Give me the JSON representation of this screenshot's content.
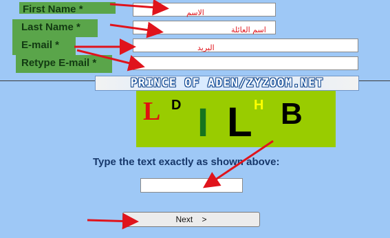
{
  "form": {
    "first_name_label": "First Name *",
    "last_name_label": "Last Name *",
    "email_label": "E-mail *",
    "retype_email_label": "Retype E-mail *",
    "first_name_hint": "الاسم",
    "last_name_hint": "اسم العائلة",
    "email_hint": "البريد"
  },
  "banner": {
    "text": "PRINCE OF ADEN/ZYZOOM.NET"
  },
  "captcha": {
    "chars": [
      {
        "ch": "L",
        "color": "#e01010"
      },
      {
        "ch": "D",
        "color": "#000000"
      },
      {
        "ch": "I",
        "color": "#17741e"
      },
      {
        "ch": "L",
        "color": "#000000"
      },
      {
        "ch": "H",
        "color": "#ffff00"
      },
      {
        "ch": "B",
        "color": "#000000"
      }
    ],
    "background": "#99cc00",
    "instruction": "Type the text exactly as shown above:"
  },
  "next_button": {
    "label": "Next    >"
  },
  "colors": {
    "annotation_arrow": "#e0141c",
    "label_bg": "#5aa54a",
    "page_bg": "#9ec8f6"
  }
}
